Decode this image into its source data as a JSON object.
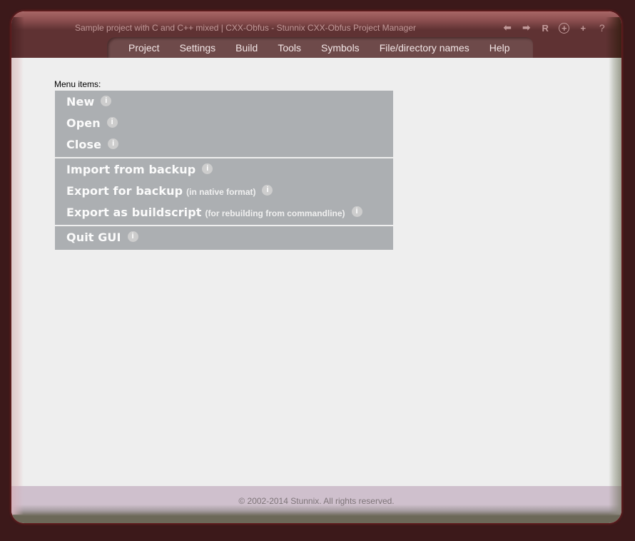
{
  "window": {
    "title": "Sample project with C and C++ mixed | CXX-Obfus - Stunnix CXX-Obfus Project Manager"
  },
  "toolbar": {
    "tools": [
      {
        "name": "back",
        "icon": "arrow-left-icon",
        "glyph": "⬅"
      },
      {
        "name": "forward",
        "icon": "arrow-right-icon",
        "glyph": "➡"
      },
      {
        "name": "reload",
        "icon": "reload-icon",
        "glyph": "R"
      },
      {
        "name": "new-window",
        "icon": "circled-plus-icon",
        "glyph": "+"
      },
      {
        "name": "zoom-in",
        "icon": "plus-icon",
        "glyph": "+"
      },
      {
        "name": "help",
        "icon": "help-icon",
        "glyph": "?"
      }
    ]
  },
  "nav": {
    "items": [
      "Project",
      "Settings",
      "Build",
      "Tools",
      "Symbols",
      "File/directory names",
      "Help"
    ]
  },
  "main": {
    "menu_label": "Menu items:",
    "groups": [
      [
        {
          "label": "New",
          "hint": ""
        },
        {
          "label": "Open",
          "hint": ""
        },
        {
          "label": "Close",
          "hint": ""
        }
      ],
      [
        {
          "label": "Import from backup",
          "hint": ""
        },
        {
          "label": "Export for backup",
          "hint": "(in native format)"
        },
        {
          "label": "Export as buildscript",
          "hint": "(for rebuilding from commandline)"
        }
      ],
      [
        {
          "label": "Quit GUI",
          "hint": ""
        }
      ]
    ],
    "info_glyph": "i"
  },
  "footer": {
    "copyright": "© 2002-2014 Stunnix. All rights reserved."
  },
  "colors": {
    "background": "#3c191a",
    "header": "#5f3233",
    "navbar": "#6e4a4a",
    "menu_bg": "#acafb2",
    "content_bg": "#eeeeee",
    "footer_bg": "#cfc0cd"
  }
}
